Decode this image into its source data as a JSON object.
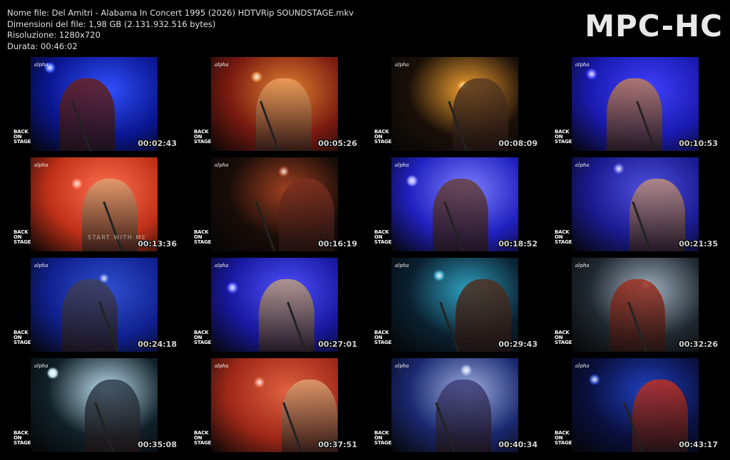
{
  "file_info": {
    "name_line": "Nome file: Del Amitri - Alabama In Concert 1995 (2026) HDTVRip SOUNDSTAGE.mkv",
    "size_line": "Dimensioni del file: 1,98 GB (2.131.932.516 bytes)",
    "resolution_line": "Risoluzione: 1280x720",
    "duration_line": "Durata: 00:46:02"
  },
  "brand": "MPC-HC",
  "overlay": {
    "channel_logo": "alpha",
    "show_logo_line1": "BACK",
    "show_logo_line2": "ON",
    "show_logo_line3": "STAGE"
  },
  "thumbnails": [
    {
      "time": "00:02:43",
      "colors": {
        "bg": "#0a1690",
        "accent": "#3050ff",
        "fig": "#6a2020"
      }
    },
    {
      "time": "00:05:26",
      "colors": {
        "bg": "#7a1a10",
        "accent": "#e08030",
        "fig": "#f0a060"
      }
    },
    {
      "time": "00:08:09",
      "colors": {
        "bg": "#1a0f08",
        "accent": "#f0a030",
        "fig": "#5a3a20"
      }
    },
    {
      "time": "00:10:53",
      "colors": {
        "bg": "#1a1ab0",
        "accent": "#4040ff",
        "fig": "#c08060"
      }
    },
    {
      "time": "00:13:36",
      "colors": {
        "bg": "#c03018",
        "accent": "#ff7050",
        "fig": "#e0a070"
      },
      "caption": "START WITH ME"
    },
    {
      "time": "00:16:19",
      "colors": {
        "bg": "#180c08",
        "accent": "#a04020",
        "fig": "#803020"
      }
    },
    {
      "time": "00:18:52",
      "colors": {
        "bg": "#2020c0",
        "accent": "#8080ff",
        "fig": "#6a4040"
      }
    },
    {
      "time": "00:21:35",
      "colors": {
        "bg": "#1a1a90",
        "accent": "#5050e0",
        "fig": "#c09080"
      }
    },
    {
      "time": "00:24:18",
      "colors": {
        "bg": "#102090",
        "accent": "#3050d0",
        "fig": "#404060"
      }
    },
    {
      "time": "00:27:01",
      "colors": {
        "bg": "#1818a0",
        "accent": "#5050ff",
        "fig": "#c0a080"
      }
    },
    {
      "time": "00:29:43",
      "colors": {
        "bg": "#0a2030",
        "accent": "#30a0c0",
        "fig": "#503020"
      }
    },
    {
      "time": "00:32:26",
      "colors": {
        "bg": "#202830",
        "accent": "#a0b0c0",
        "fig": "#a03020"
      }
    },
    {
      "time": "00:35:08",
      "colors": {
        "bg": "#102028",
        "accent": "#c0e0f0",
        "fig": "#304050"
      }
    },
    {
      "time": "00:37:51",
      "colors": {
        "bg": "#a02818",
        "accent": "#e06040",
        "fig": "#e0a070"
      }
    },
    {
      "time": "00:40:34",
      "colors": {
        "bg": "#1a2870",
        "accent": "#a0b0e0",
        "fig": "#404080"
      }
    },
    {
      "time": "00:43:17",
      "colors": {
        "bg": "#0a1040",
        "accent": "#2040c0",
        "fig": "#c03020"
      }
    }
  ]
}
